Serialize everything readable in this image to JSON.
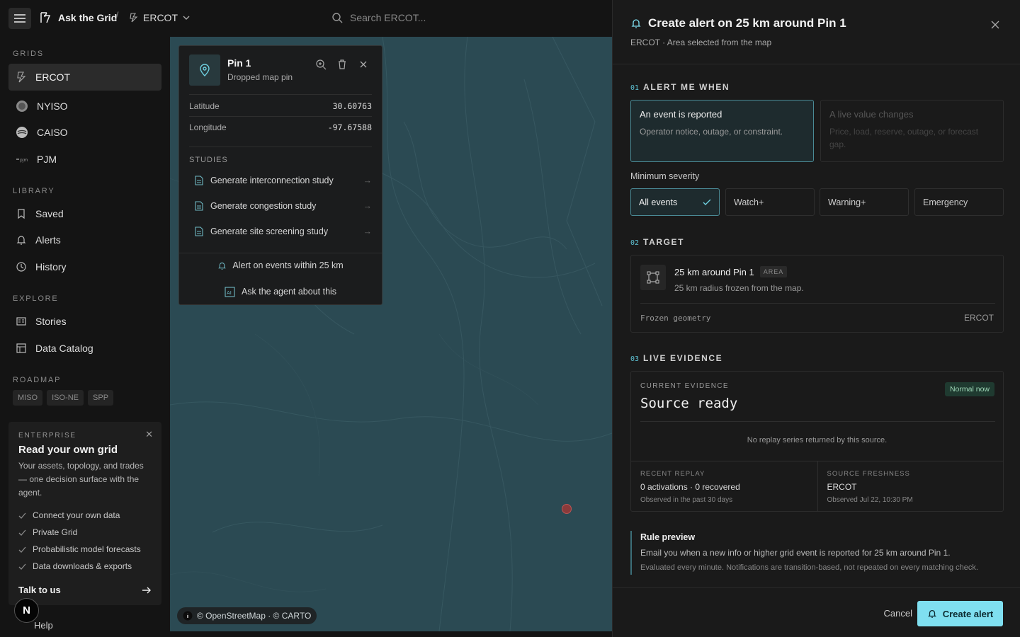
{
  "header": {
    "brand": "Ask the Grid",
    "grid": "ERCOT",
    "search_placeholder": "Search ERCOT..."
  },
  "sidebar": {
    "grids_label": "GRIDS",
    "grids": [
      "ERCOT",
      "NYISO",
      "CAISO",
      "PJM"
    ],
    "library_label": "LIBRARY",
    "library": [
      "Saved",
      "Alerts",
      "History"
    ],
    "explore_label": "EXPLORE",
    "explore": [
      "Stories",
      "Data Catalog"
    ],
    "roadmap_label": "ROADMAP",
    "roadmap": [
      "MISO",
      "ISO-NE",
      "SPP"
    ],
    "enterprise": {
      "label": "ENTERPRISE",
      "title": "Read your own grid",
      "desc": "Your assets, topology, and trades — one decision surface with the agent.",
      "items": [
        "Connect your own data",
        "Private Grid",
        "Probabilistic model forecasts",
        "Data downloads & exports"
      ],
      "cta": "Talk to us"
    },
    "help": "Help",
    "avatar": "N"
  },
  "map": {
    "attribution": "© OpenStreetMap · © CARTO"
  },
  "popup": {
    "title": "Pin 1",
    "subtitle": "Dropped map pin",
    "lat_label": "Latitude",
    "lat": "30.60763",
    "lon_label": "Longitude",
    "lon": "-97.67588",
    "studies_label": "STUDIES",
    "studies": [
      "Generate interconnection study",
      "Generate congestion study",
      "Generate site screening study"
    ],
    "alert_btn": "Alert on events within 25 km",
    "agent_btn": "Ask the agent about this"
  },
  "panel": {
    "title": "Create alert on 25 km around Pin 1",
    "subtitle": "ERCOT · Area selected from the map",
    "step1": {
      "num": "01",
      "label": "ALERT ME WHEN"
    },
    "opt1": {
      "title": "An event is reported",
      "desc": "Operator notice, outage, or constraint."
    },
    "opt2": {
      "title": "A live value changes",
      "desc": "Price, load, reserve, outage, or forecast gap."
    },
    "severity_label": "Minimum severity",
    "severities": [
      "All events",
      "Watch+",
      "Warning+",
      "Emergency"
    ],
    "step2": {
      "num": "02",
      "label": "TARGET"
    },
    "target": {
      "title": "25 km around Pin 1",
      "tag": "AREA",
      "desc": "25 km radius frozen from the map.",
      "geom": "Frozen geometry",
      "grid": "ERCOT"
    },
    "step3": {
      "num": "03",
      "label": "LIVE EVIDENCE"
    },
    "evidence": {
      "label": "CURRENT EVIDENCE",
      "value": "Source ready",
      "badge": "Normal now",
      "empty": "No replay series returned by this source.",
      "replay_label": "RECENT REPLAY",
      "replay_value": "0 activations · 0 recovered",
      "replay_note": "Observed in the past 30 days",
      "fresh_label": "SOURCE FRESHNESS",
      "fresh_value": "ERCOT",
      "fresh_note": "Observed Jul 22, 10:30 PM"
    },
    "rule": {
      "title": "Rule preview",
      "text": "Email you when a new info or higher grid event is reported for 25 km around Pin 1.",
      "note": "Evaluated every minute. Notifications are transition-based, not repeated on every matching check."
    },
    "cancel": "Cancel",
    "create": "Create alert"
  },
  "colors": {
    "accent": "#7fdff0",
    "map": "#2b4a53",
    "pin": "#8a3a3a"
  }
}
